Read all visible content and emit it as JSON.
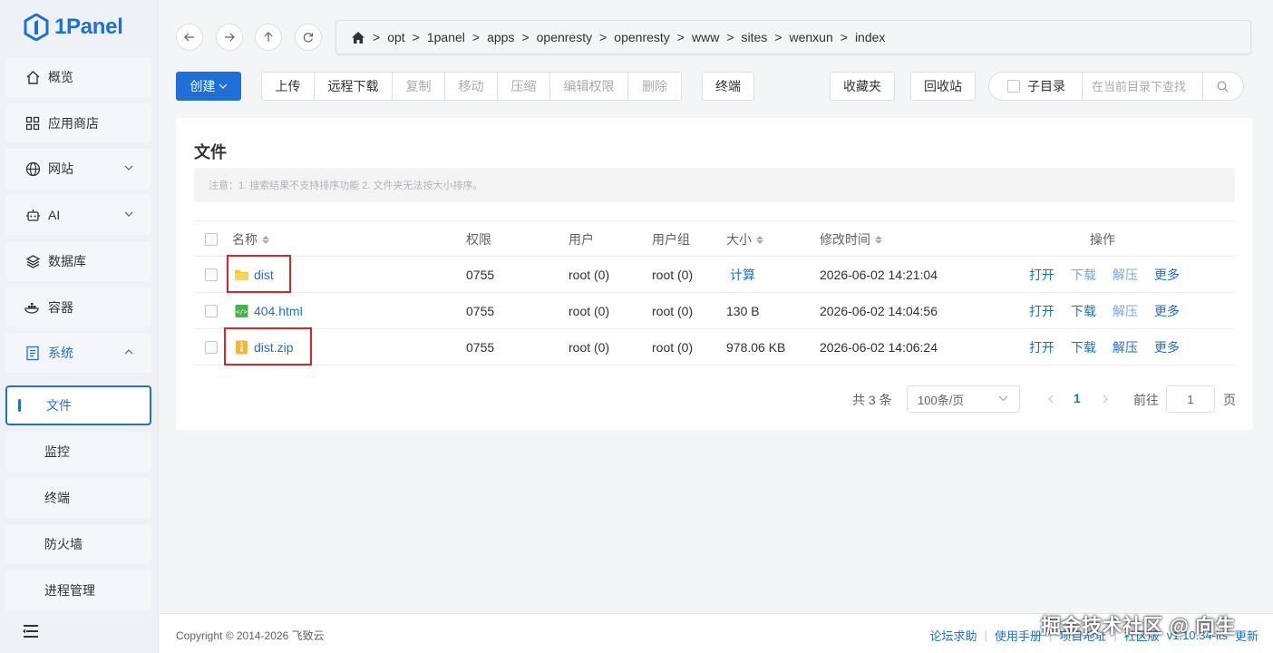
{
  "app": {
    "logo_text": "1Panel"
  },
  "sidebar": {
    "items": [
      {
        "label": "概览",
        "icon": "home-icon"
      },
      {
        "label": "应用商店",
        "icon": "grid-icon"
      },
      {
        "label": "网站",
        "icon": "globe-icon",
        "expandable": true
      },
      {
        "label": "AI",
        "icon": "robot-icon",
        "expandable": true
      },
      {
        "label": "数据库",
        "icon": "database-icon"
      },
      {
        "label": "容器",
        "icon": "container-icon"
      },
      {
        "label": "系统",
        "icon": "system-icon",
        "expanded": true
      }
    ],
    "sub_items": [
      {
        "label": "文件",
        "active": true
      },
      {
        "label": "监控"
      },
      {
        "label": "终端"
      },
      {
        "label": "防火墙"
      },
      {
        "label": "进程管理"
      }
    ]
  },
  "breadcrumb": [
    "opt",
    "1panel",
    "apps",
    "openresty",
    "openresty",
    "www",
    "sites",
    "wenxun",
    "index"
  ],
  "breadcrumb_sep": ">",
  "toolbar": {
    "create": "创建",
    "group1": [
      {
        "label": "上传",
        "disabled": false
      },
      {
        "label": "远程下载",
        "disabled": false
      },
      {
        "label": "复制",
        "disabled": true
      },
      {
        "label": "移动",
        "disabled": true
      },
      {
        "label": "压缩",
        "disabled": true
      },
      {
        "label": "编辑权限",
        "disabled": true
      },
      {
        "label": "删除",
        "disabled": true
      }
    ],
    "terminal": "终端",
    "favorites": "收藏夹",
    "recycle_bin": "回收站",
    "subdir_label": "子目录",
    "search_placeholder": "在当前目录下查找"
  },
  "card": {
    "title": "文件",
    "notice": "注意：1. 搜索结果不支持排序功能 2. 文件夹无法按大小排序。"
  },
  "table": {
    "headers": {
      "name": "名称",
      "perm": "权限",
      "user": "用户",
      "group": "用户组",
      "size": "大小",
      "mtime": "修改时间",
      "ops": "操作"
    },
    "rows": [
      {
        "name": "dist",
        "type": "folder",
        "perm": "0755",
        "user": "root (0)",
        "group": "root (0)",
        "size": "计算",
        "size_is_link": true,
        "mtime": "2026-06-02 14:21:04",
        "highlighted": true
      },
      {
        "name": "404.html",
        "type": "html",
        "perm": "0755",
        "user": "root (0)",
        "group": "root (0)",
        "size": "130 B",
        "size_is_link": false,
        "mtime": "2026-06-02 14:04:56",
        "highlighted": false
      },
      {
        "name": "dist.zip",
        "type": "zip",
        "perm": "0755",
        "user": "root (0)",
        "group": "root (0)",
        "size": "978.06 KB",
        "size_is_link": false,
        "mtime": "2026-06-02 14:06:24",
        "highlighted": true
      }
    ],
    "ops": {
      "open": "打开",
      "download": "下载",
      "extract": "解压",
      "more": "更多"
    }
  },
  "pagination": {
    "total": "共 3 条",
    "page_size": "100条/页",
    "current_page": "1",
    "goto_label": "前往",
    "goto_value": "1",
    "page_unit": "页"
  },
  "footer": {
    "copyright": "Copyright © 2014-2026 飞致云",
    "links": [
      "论坛求助",
      "使用手册",
      "项目地址",
      "社区版"
    ],
    "version": "v1.10.34-lts",
    "update": "更新"
  },
  "watermark": "掘金技术社区 @ 向生",
  "colors": {
    "accent": "#1f6fd6",
    "highlight_box": "#d9262b",
    "folder": "#f6c445",
    "html_file": "#4caf50",
    "zip_file": "#f3b63a"
  }
}
